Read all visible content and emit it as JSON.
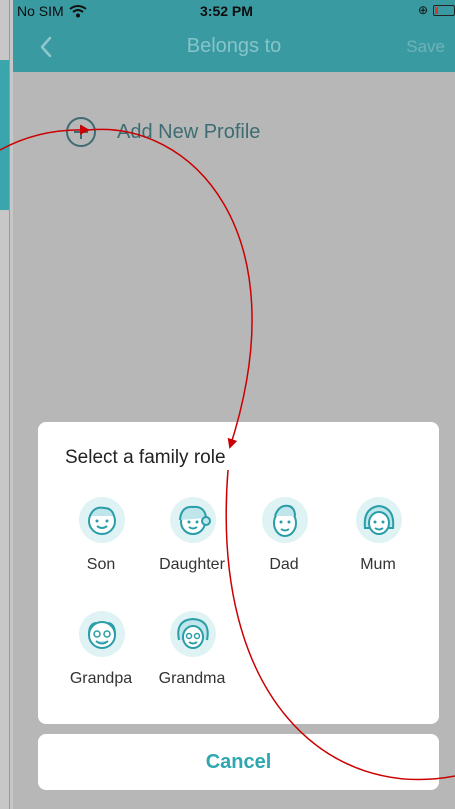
{
  "status_bar": {
    "carrier": "No SIM",
    "time": "3:52 PM"
  },
  "nav": {
    "title": "Belongs to",
    "save_label": "Save",
    "back_icon": "chevron-left-icon"
  },
  "add_profile": {
    "label": "Add New Profile",
    "icon": "add-circle-icon"
  },
  "role_sheet": {
    "title": "Select a family role",
    "roles": [
      {
        "label": "Son",
        "icon": "son-face-icon"
      },
      {
        "label": "Daughter",
        "icon": "daughter-face-icon"
      },
      {
        "label": "Dad",
        "icon": "dad-face-icon"
      },
      {
        "label": "Mum",
        "icon": "mum-face-icon"
      },
      {
        "label": "Grandpa",
        "icon": "grandpa-face-icon"
      },
      {
        "label": "Grandma",
        "icon": "grandma-face-icon"
      }
    ]
  },
  "cancel_label": "Cancel",
  "colors": {
    "accent": "#3a9aa2",
    "cancel_text": "#2fa7b0",
    "icon_fill": "#dff2f4",
    "icon_stroke": "#2a9ea8",
    "arrow": "#cc0000"
  }
}
